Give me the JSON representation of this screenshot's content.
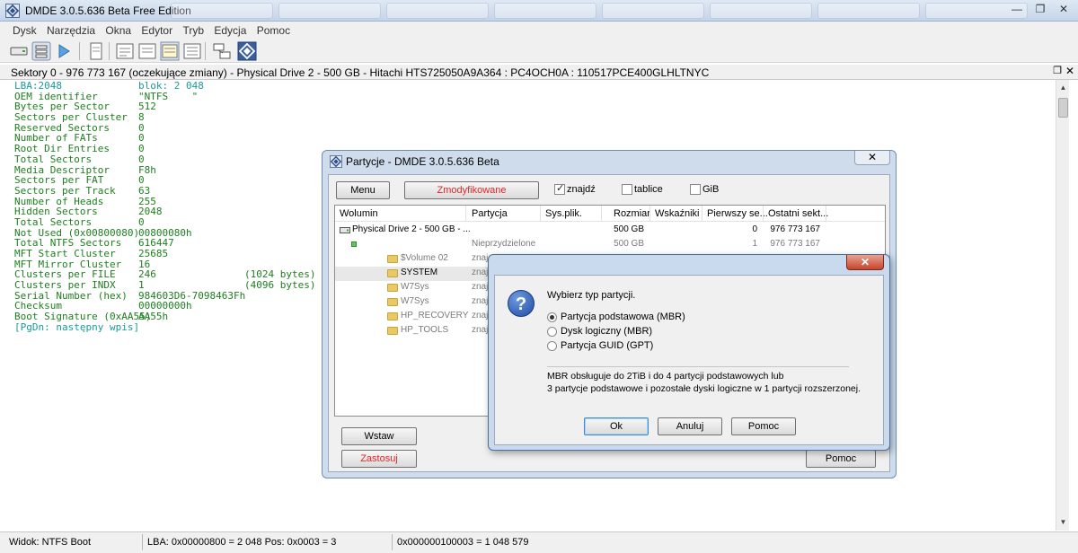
{
  "window": {
    "title": "DMDE 3.0.5.636 Beta Free Edition",
    "restore_glyph": "❐",
    "close_glyph": "✕",
    "minimize_glyph": "—"
  },
  "menu": [
    "Dysk",
    "Narzędzia",
    "Okna",
    "Edytor",
    "Tryb",
    "Edycja",
    "Pomoc"
  ],
  "sector_header": {
    "text": "Sektory 0 - 976 773 167 (oczekujące zmiany) - Physical Drive 2 - 500 GB - Hitachi HTS725050A9A364 : PC4OCH0A : 110517PCE400GLHLTNYC",
    "restore_glyph": "❐",
    "close_glyph": "✕"
  },
  "boot_sector": {
    "lba": "LBA:2048",
    "block": "blok: 2 048",
    "fields": [
      {
        "name": "OEM identifier",
        "value": "\"NTFS    \"",
        "note": ""
      },
      {
        "name": "Bytes per Sector",
        "value": "512",
        "note": ""
      },
      {
        "name": "Sectors per Cluster",
        "value": "8",
        "note": ""
      },
      {
        "name": "Reserved Sectors",
        "value": "0",
        "note": ""
      },
      {
        "name": "Number of FATs",
        "value": "0",
        "note": ""
      },
      {
        "name": "Root Dir Entries",
        "value": "0",
        "note": ""
      },
      {
        "name": "Total Sectors",
        "value": "0",
        "note": ""
      },
      {
        "name": "Media Descriptor",
        "value": "F8h",
        "note": ""
      },
      {
        "name": "Sectors per FAT",
        "value": "0",
        "note": ""
      },
      {
        "name": "Sectors per Track",
        "value": "63",
        "note": ""
      },
      {
        "name": "Number of Heads",
        "value": "255",
        "note": ""
      },
      {
        "name": "Hidden Sectors",
        "value": "2048",
        "note": ""
      },
      {
        "name": "Total Sectors",
        "value": "0",
        "note": ""
      },
      {
        "name": "Not Used (0x00800080)",
        "value": "00800080h",
        "note": ""
      },
      {
        "name": "Total NTFS Sectors",
        "value": "616447",
        "note": ""
      },
      {
        "name": "MFT Start Cluster",
        "value": "25685",
        "note": ""
      },
      {
        "name": "MFT Mirror Cluster",
        "value": "16",
        "note": ""
      },
      {
        "name": "Clusters per FILE",
        "value": "246",
        "note": "(1024 bytes)"
      },
      {
        "name": "Clusters per INDX",
        "value": "1",
        "note": "(4096 bytes)"
      },
      {
        "name": "Serial Number (hex)",
        "value": "984603D6-7098463Fh",
        "note": ""
      },
      {
        "name": "Checksum",
        "value": "00000000h",
        "note": ""
      },
      {
        "name": "Boot Signature (0xAA55)",
        "value": "AA55h",
        "note": ""
      }
    ],
    "pgdn": "[PgDn: następny wpis]"
  },
  "statusbar": {
    "view": "Widok:  NTFS Boot",
    "lba": "LBA: 0x00000800 = 2 048  Pos: 0x0003 = 3",
    "offset": "0x000000100003 = 1 048 579"
  },
  "partitions_dialog": {
    "title": "Partycje - DMDE 3.0.5.636 Beta",
    "close_glyph": "✕",
    "menu_button": "Menu",
    "modified_button": "Zmodyfikowane",
    "checkboxes": [
      {
        "label": "znajdź",
        "checked": true
      },
      {
        "label": "tablice",
        "checked": false
      },
      {
        "label": "GiB",
        "checked": false
      }
    ],
    "columns": [
      "Wolumin",
      "Partycja",
      "Sys.plik.",
      "Rozmiar",
      "Wskaźniki",
      "Pierwszy se...",
      "Ostatni sekt..."
    ],
    "rows": [
      {
        "volume": "Physical Drive 2 - 500 GB - ...",
        "partition": "",
        "fs": "",
        "size": "500 GB",
        "flags": "",
        "first": "0",
        "last": "976 773 167"
      },
      {
        "volume": "",
        "partition": "Nieprzydzielone",
        "fs": "",
        "size": "500 GB",
        "flags": "",
        "first": "1",
        "last": "976 773 167"
      },
      {
        "volume": "$Volume 02",
        "partition": "znaj",
        "fs": "",
        "size": "",
        "flags": "",
        "first": "",
        "last": ""
      },
      {
        "volume": "SYSTEM",
        "partition": "znaj",
        "fs": "",
        "size": "",
        "flags": "",
        "first": "",
        "last": ""
      },
      {
        "volume": "W7Sys",
        "partition": "znaj",
        "fs": "",
        "size": "",
        "flags": "",
        "first": "",
        "last": ""
      },
      {
        "volume": "W7Sys",
        "partition": "znaj",
        "fs": "",
        "size": "",
        "flags": "",
        "first": "",
        "last": ""
      },
      {
        "volume": "HP_RECOVERY",
        "partition": "znaj",
        "fs": "",
        "size": "",
        "flags": "",
        "first": "",
        "last": ""
      },
      {
        "volume": "HP_TOOLS",
        "partition": "znaj",
        "fs": "",
        "size": "",
        "flags": "",
        "first": "",
        "last": ""
      }
    ],
    "insert_button": "Wstaw",
    "apply_button": "Zastosuj",
    "help_button": "Pomoc"
  },
  "type_dialog": {
    "close_glyph": "✕",
    "question_glyph": "?",
    "prompt": "Wybierz typ partycji.",
    "options": [
      {
        "label": "Partycja podstawowa (MBR)",
        "selected": true
      },
      {
        "label": "Dysk logiczny (MBR)",
        "selected": false
      },
      {
        "label": "Partycja GUID (GPT)",
        "selected": false
      }
    ],
    "info_line1": "MBR obsługuje do 2TiB i do 4 partycji podstawowych lub",
    "info_line2": "3 partycje podstawowe i pozostałe dyski logiczne w 1 partycji rozszerzonej.",
    "ok_button": "Ok",
    "cancel_button": "Anuluj",
    "help_button": "Pomoc"
  },
  "colors": {
    "text_green": "#1e7e1e",
    "accent_red": "#e32626"
  }
}
